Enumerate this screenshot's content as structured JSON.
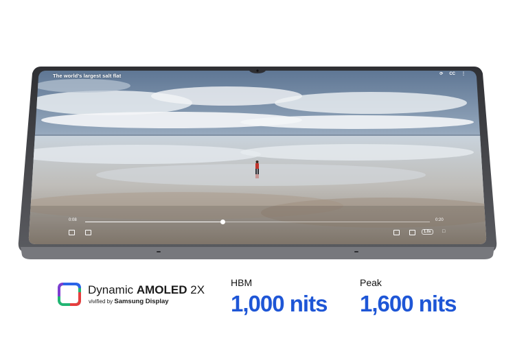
{
  "video": {
    "title": "The world's largest salt flat",
    "current_time": "0:08",
    "duration": "0:20",
    "progress": 0.4,
    "speed_label": "1.0x",
    "cc_label": "CC"
  },
  "brand": {
    "line1_regular": "Dynamic ",
    "line1_bold": "AMOLED",
    "line1_suffix": " 2X",
    "line2_prefix": "vivified by ",
    "line2_bold": "Samsung Display"
  },
  "stats": [
    {
      "label": "HBM",
      "value": "1,000 nits"
    },
    {
      "label": "Peak",
      "value": "1,600 nits"
    }
  ],
  "colors": {
    "accent_blue": "#1e56d6",
    "frame": "#3c3d41"
  },
  "icons": [
    "rotate-icon",
    "more-icon",
    "screenshot-icon",
    "subtitle-icon",
    "pip-icon",
    "cast-icon",
    "lock-icon"
  ]
}
